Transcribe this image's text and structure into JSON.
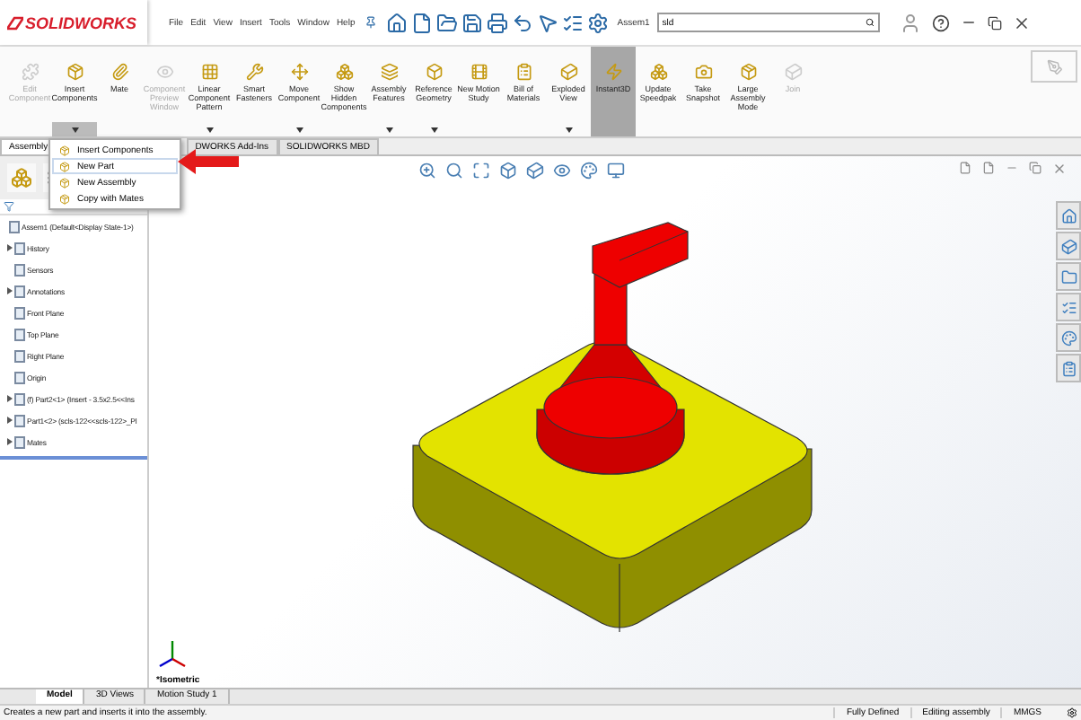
{
  "app": {
    "logo": "SOLIDWORKS",
    "menus": [
      "File",
      "Edit",
      "View",
      "Insert",
      "Tools",
      "Window",
      "Help"
    ],
    "document": "Assem1",
    "search": {
      "value": "sld"
    }
  },
  "ribbon": {
    "buttons": [
      {
        "label": "Edit Component",
        "disabled": true,
        "selected": false,
        "menu": false
      },
      {
        "label": "Insert Components",
        "disabled": false,
        "selected": false,
        "menu": true
      },
      {
        "label": "Mate",
        "disabled": false,
        "selected": false,
        "menu": false
      },
      {
        "label": "Component Preview Window",
        "disabled": true,
        "selected": false,
        "menu": false
      },
      {
        "label": "Linear Component Pattern",
        "disabled": false,
        "selected": false,
        "menu": true
      },
      {
        "label": "Smart Fasteners",
        "disabled": false,
        "selected": false,
        "menu": false
      },
      {
        "label": "Move Component",
        "disabled": false,
        "selected": false,
        "menu": true
      },
      {
        "label": "Show Hidden Components",
        "disabled": false,
        "selected": false,
        "menu": false
      },
      {
        "label": "Assembly Features",
        "disabled": false,
        "selected": false,
        "menu": true
      },
      {
        "label": "Reference Geometry",
        "disabled": false,
        "selected": false,
        "menu": true
      },
      {
        "label": "New Motion Study",
        "disabled": false,
        "selected": false,
        "menu": false
      },
      {
        "label": "Bill of Materials",
        "disabled": false,
        "selected": false,
        "menu": false
      },
      {
        "label": "Exploded View",
        "disabled": false,
        "selected": false,
        "menu": true
      },
      {
        "label": "Instant3D",
        "disabled": false,
        "selected": true,
        "menu": false
      },
      {
        "label": "Update Speedpak",
        "disabled": false,
        "selected": false,
        "menu": false
      },
      {
        "label": "Take Snapshot",
        "disabled": false,
        "selected": false,
        "menu": false
      },
      {
        "label": "Large Assembly Mode",
        "disabled": false,
        "selected": false,
        "menu": false
      },
      {
        "label": "Join",
        "disabled": true,
        "selected": false,
        "menu": false
      }
    ]
  },
  "command_tabs": [
    {
      "label": "Assembly",
      "selected": true
    },
    {
      "label": "DWORKS Add-Ins",
      "selected": false
    },
    {
      "label": "SOLIDWORKS MBD",
      "selected": false
    }
  ],
  "dropdown_menu": [
    {
      "label": "Insert Components",
      "selected": false
    },
    {
      "label": "New Part",
      "selected": true
    },
    {
      "label": "New Assembly",
      "selected": false
    },
    {
      "label": "Copy with Mates",
      "selected": false
    }
  ],
  "feature_tree": [
    {
      "label": "Assem1  (Default<Display State-1>)",
      "children": [
        {
          "label": "History",
          "expanded": false
        },
        {
          "label": "Sensors"
        },
        {
          "label": "Annotations",
          "expanded": false
        },
        {
          "label": "Front Plane"
        },
        {
          "label": "Top Plane"
        },
        {
          "label": "Right Plane"
        },
        {
          "label": "Origin"
        },
        {
          "label": "(f) Part2<1> (Insert - 3.5x2.5<<Ins",
          "expanded": false
        },
        {
          "label": "Part1<2> (scls-122<<scls-122>_Pl",
          "expanded": false
        },
        {
          "label": "Mates",
          "expanded": false
        }
      ]
    }
  ],
  "viewport": {
    "view_name": "*Isometric"
  },
  "bottom_tabs": [
    {
      "label": "Model",
      "selected": true
    },
    {
      "label": "3D Views",
      "selected": false
    },
    {
      "label": "Motion Study 1",
      "selected": false
    }
  ],
  "status_bar": {
    "message": "Creates a new part and inserts it into the assembly.",
    "fields": [
      "Fully Defined",
      "Editing assembly",
      "MMGS"
    ]
  }
}
